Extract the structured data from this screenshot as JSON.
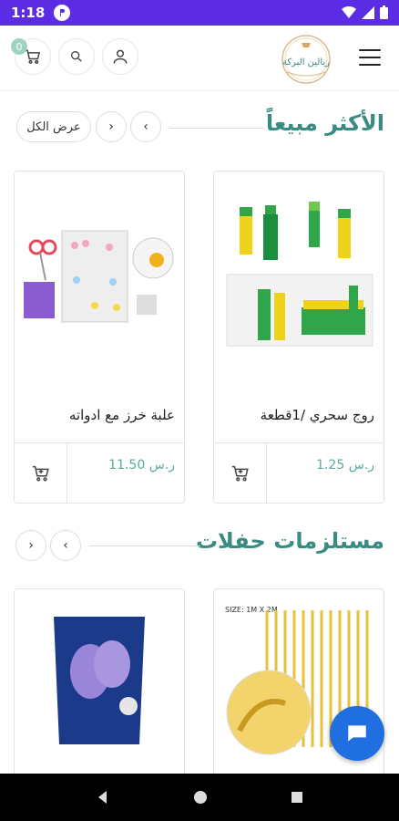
{
  "status_bar": {
    "time": "1:18"
  },
  "header": {
    "cart_count": "0",
    "logo_text": "ريالين البركة",
    "icons": [
      "cart-icon",
      "search-icon",
      "user-icon",
      "hamburger-menu-icon"
    ]
  },
  "sections": [
    {
      "title": "الأكثر مبيعاً",
      "view_all": "عرض الكل",
      "products": [
        {
          "name": "روج سحري /1قطعة",
          "price": "1.25 ر.س"
        },
        {
          "name": "علبة خرز مع ادواته",
          "price": "11.50 ر.س"
        }
      ]
    },
    {
      "title": "مستلزمات حفلات",
      "products": [
        {
          "name": "",
          "price": "",
          "image_text": "SIZE: 1M X 2M"
        },
        {
          "name": "",
          "price": ""
        }
      ]
    }
  ],
  "colors": {
    "accent": "#3a8c82",
    "status_bar": "#5b2ce3",
    "price": "#5aa99d",
    "chat": "#1f6fe0"
  }
}
